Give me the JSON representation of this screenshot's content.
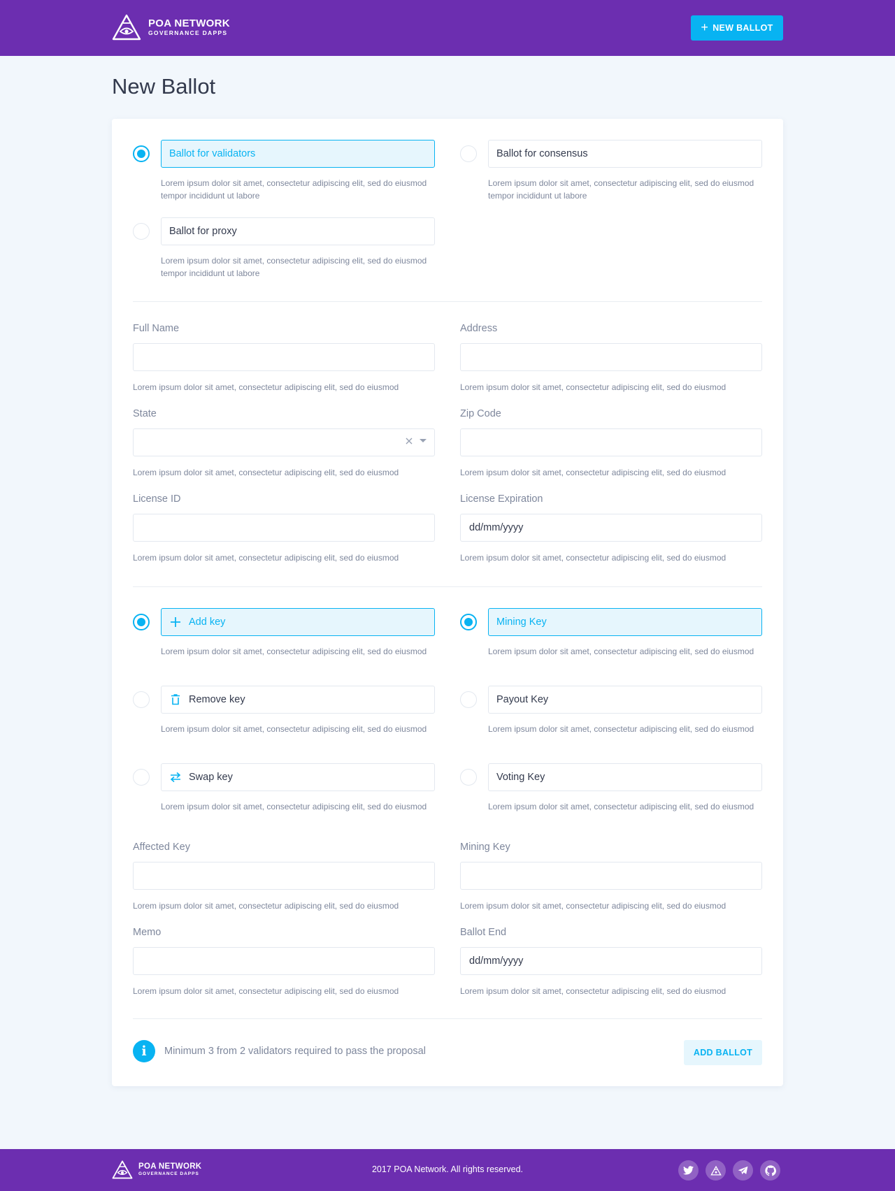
{
  "header": {
    "logo_title": "POA NETWORK",
    "logo_subtitle": "GOVERNANCE DAPPS",
    "new_ballot_label": "NEW BALLOT"
  },
  "page_title": "New Ballot",
  "ballot_types": [
    {
      "label": "Ballot for validators",
      "checked": true,
      "desc": "Lorem ipsum dolor sit amet, consectetur adipiscing elit, sed do eiusmod tempor incididunt ut labore"
    },
    {
      "label": "Ballot for consensus",
      "checked": false,
      "desc": "Lorem ipsum dolor sit amet, consectetur adipiscing elit, sed do eiusmod tempor incididunt ut labore"
    },
    {
      "label": "Ballot for proxy",
      "checked": false,
      "desc": "Lorem ipsum dolor sit amet, consectetur adipiscing elit, sed do eiusmod tempor incididunt ut labore"
    }
  ],
  "fields": {
    "full_name": {
      "label": "Full Name",
      "value": "",
      "hint": "Lorem ipsum dolor sit amet, consectetur adipiscing elit, sed do eiusmod"
    },
    "address": {
      "label": "Address",
      "value": "",
      "hint": "Lorem ipsum dolor sit amet, consectetur adipiscing elit, sed do eiusmod"
    },
    "state": {
      "label": "State",
      "value": "",
      "hint": "Lorem ipsum dolor sit amet, consectetur adipiscing elit, sed do eiusmod"
    },
    "zip_code": {
      "label": "Zip Code",
      "value": "",
      "hint": "Lorem ipsum dolor sit amet, consectetur adipiscing elit, sed do eiusmod"
    },
    "license_id": {
      "label": "License ID",
      "value": "",
      "hint": "Lorem ipsum dolor sit amet, consectetur adipiscing elit, sed do eiusmod"
    },
    "license_expiration": {
      "label": "License Expiration",
      "value": "dd/mm/yyyy",
      "hint": "Lorem ipsum dolor sit amet, consectetur adipiscing elit, sed do eiusmod"
    },
    "affected_key": {
      "label": "Affected Key",
      "value": "",
      "hint": "Lorem ipsum dolor sit amet, consectetur adipiscing elit, sed do eiusmod"
    },
    "mining_key": {
      "label": "Mining Key",
      "value": "",
      "hint": "Lorem ipsum dolor sit amet, consectetur adipiscing elit, sed do eiusmod"
    },
    "memo": {
      "label": "Memo",
      "value": "",
      "hint": "Lorem ipsum dolor sit amet, consectetur adipiscing elit, sed do eiusmod"
    },
    "ballot_end": {
      "label": "Ballot End",
      "value": "dd/mm/yyyy",
      "hint": "Lorem ipsum dolor sit amet, consectetur adipiscing elit, sed do eiusmod"
    }
  },
  "key_actions": [
    {
      "label": "Add key",
      "icon": "plus-icon",
      "checked": true,
      "desc": "Lorem ipsum dolor sit amet, consectetur adipiscing elit, sed do eiusmod"
    },
    {
      "label": "Remove key",
      "icon": "trash-icon",
      "checked": false,
      "desc": "Lorem ipsum dolor sit amet, consectetur adipiscing elit, sed do eiusmod"
    },
    {
      "label": "Swap key",
      "icon": "swap-icon",
      "checked": false,
      "desc": "Lorem ipsum dolor sit amet, consectetur adipiscing elit, sed do eiusmod"
    }
  ],
  "key_types": [
    {
      "label": "Mining Key",
      "checked": true,
      "desc": "Lorem ipsum dolor sit amet, consectetur adipiscing elit, sed do eiusmod"
    },
    {
      "label": "Payout Key",
      "checked": false,
      "desc": "Lorem ipsum dolor sit amet, consectetur adipiscing elit, sed do eiusmod"
    },
    {
      "label": "Voting Key",
      "checked": false,
      "desc": "Lorem ipsum dolor sit amet, consectetur adipiscing elit, sed do eiusmod"
    }
  ],
  "note": {
    "icon": "info-icon",
    "text": "Minimum 3 from 2 validators required to pass the proposal"
  },
  "add_ballot_label": "ADD BALLOT",
  "footer": {
    "logo_title": "POA NETWORK",
    "logo_subtitle": "GOVERNANCE DAPPS",
    "copyright": "2017 POA Network. All rights reserved.",
    "socials": [
      "twitter-icon",
      "poa-icon",
      "telegram-icon",
      "github-icon"
    ]
  },
  "colors": {
    "brand": "#6c2eb0",
    "accent": "#08b3f2",
    "accent_light": "#e6f6fd",
    "background": "#f2f7fc"
  }
}
